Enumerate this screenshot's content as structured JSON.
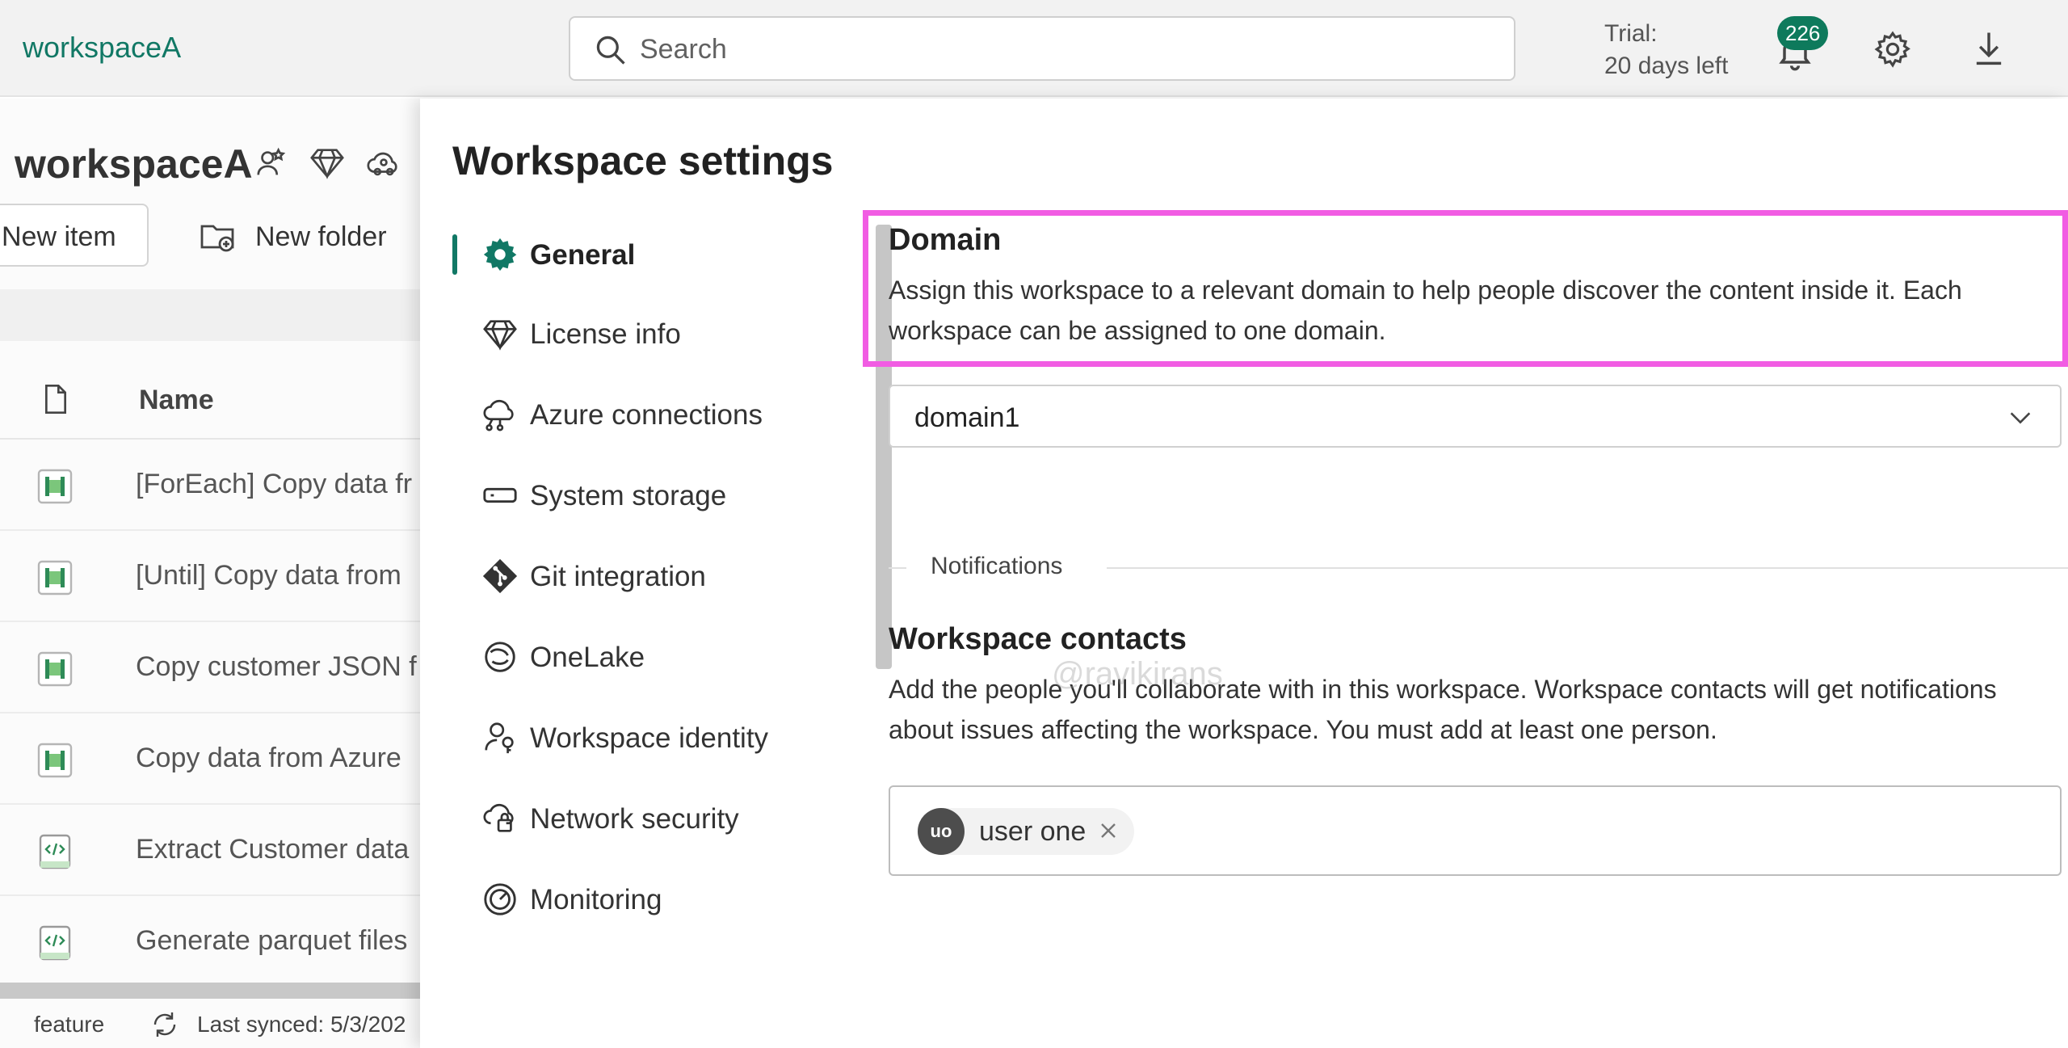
{
  "topbar": {
    "workspace_name": "workspaceA",
    "search_placeholder": "Search",
    "trial_line1": "Trial:",
    "trial_line2": "20 days left",
    "notification_count": "226"
  },
  "workspace": {
    "title": "workspaceA",
    "new_item_label": "New item",
    "new_folder_label": "New folder",
    "column_name": "Name",
    "rows": [
      {
        "name": "[ForEach] Copy data fr",
        "icon": "pipeline-icon"
      },
      {
        "name": "[Until] Copy data from",
        "icon": "pipeline-icon"
      },
      {
        "name": "Copy customer JSON f",
        "icon": "pipeline-icon"
      },
      {
        "name": "Copy data from Azure",
        "icon": "pipeline-icon"
      },
      {
        "name": "Extract Customer data",
        "icon": "notebook-icon"
      },
      {
        "name": "Generate parquet files",
        "icon": "notebook-icon"
      }
    ],
    "footer_branch": "feature",
    "footer_sync": "Last synced: 5/3/202"
  },
  "settings": {
    "title": "Workspace settings",
    "nav": [
      {
        "label": "General",
        "icon": "gear-icon",
        "active": true
      },
      {
        "label": "License info",
        "icon": "diamond-icon",
        "active": false
      },
      {
        "label": "Azure connections",
        "icon": "cloud-link-icon",
        "active": false
      },
      {
        "label": "System storage",
        "icon": "storage-icon",
        "active": false
      },
      {
        "label": "Git integration",
        "icon": "git-icon",
        "active": false
      },
      {
        "label": "OneLake",
        "icon": "onelake-icon",
        "active": false
      },
      {
        "label": "Workspace identity",
        "icon": "identity-icon",
        "active": false
      },
      {
        "label": "Network security",
        "icon": "network-icon",
        "active": false
      },
      {
        "label": "Monitoring",
        "icon": "monitoring-icon",
        "active": false
      }
    ],
    "domain": {
      "title": "Domain",
      "description": "Assign this workspace to a relevant domain to help people discover the content inside it. Each workspace can be assigned to one domain.",
      "selected": "domain1"
    },
    "notifications_label": "Notifications",
    "contacts": {
      "title": "Workspace contacts",
      "description": "Add the people you'll collaborate with in this workspace. Workspace contacts will get notifications about issues affecting the workspace. You must add at least one person.",
      "chip_initials": "uo",
      "chip_name": "user one"
    },
    "watermark": "@ravikirans"
  },
  "colors": {
    "accent": "#117865",
    "highlight": "#f15ce3",
    "badge": "#0e7a5c"
  }
}
